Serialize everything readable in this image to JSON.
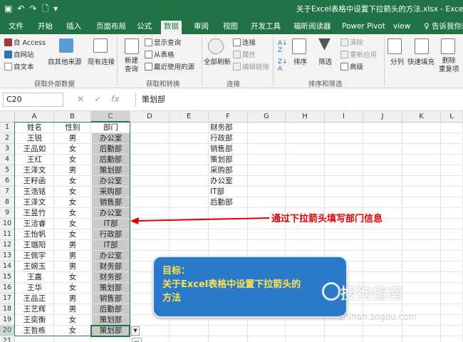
{
  "window": {
    "title": "关于Excel表格中设置下拉箭头的方法.xlsx - Excel"
  },
  "qat": {
    "save_icon": "save-icon",
    "undo_icon": "undo-icon",
    "redo_icon": "redo-icon",
    "print_preview_icon": "print-preview-icon",
    "customize_icon": "customize-icon"
  },
  "ribbon_tabs": [
    "文件",
    "开始",
    "插入",
    "页面布局",
    "公式",
    "数据",
    "审阅",
    "视图",
    "开发工具",
    "福昕阅读器",
    "Power Pivot",
    "view",
    "告诉我你想"
  ],
  "active_tab": "数据",
  "ribbon": {
    "from_access": "自 Access",
    "from_web": "自网站",
    "from_text": "自文本",
    "from_other": "自其他来源",
    "existing_conn": "现有连接",
    "group_external": "获取外部数据",
    "new_query_line1": "新建",
    "new_query_line2": "查询",
    "show_queries": "显示查询",
    "from_table": "从表格",
    "recent_sources": "最近使用的源",
    "group_transform": "获取和转换",
    "refresh_all": "全部刷新",
    "connections": "连接",
    "properties": "属性",
    "edit_links": "编辑链接",
    "group_connections": "连接",
    "sort": "排序",
    "filter": "筛选",
    "clear": "清除",
    "reapply": "重新应用",
    "advanced": "高级",
    "group_sort": "排序和筛选",
    "text_to_columns": "分列",
    "flash_fill": "快速填充",
    "remove_dup_line1": "删除",
    "remove_dup_line2": "重复项"
  },
  "formula_bar": {
    "name_box": "C20",
    "cancel_icon": "✕",
    "enter_icon": "✓",
    "fx_icon": "fx",
    "value": "策划部"
  },
  "columns": [
    "A",
    "B",
    "C",
    "D",
    "E",
    "F",
    "G",
    "H",
    "I",
    "J",
    "K",
    "L"
  ],
  "rows": [
    "1",
    "2",
    "3",
    "4",
    "5",
    "6",
    "7",
    "8",
    "9",
    "10",
    "11",
    "12",
    "13",
    "14",
    "15",
    "16",
    "17",
    "18",
    "19",
    "20",
    "21"
  ],
  "table": {
    "headers": [
      "姓名",
      "性别",
      "部门"
    ],
    "data": [
      [
        "王锐",
        "男",
        "办公室"
      ],
      [
        "王品如",
        "女",
        "后勤部"
      ],
      [
        "王红",
        "女",
        "后勤部"
      ],
      [
        "王泽文",
        "男",
        "策划部"
      ],
      [
        "王籽函",
        "女",
        "办公室"
      ],
      [
        "王浩铭",
        "女",
        "采购部"
      ],
      [
        "王泽文",
        "女",
        "销售部"
      ],
      [
        "王昱竹",
        "女",
        "办公室"
      ],
      [
        "王洽睿",
        "女",
        "IT部"
      ],
      [
        "王怡帆",
        "女",
        "行政部"
      ],
      [
        "王璐阳",
        "男",
        "IT部"
      ],
      [
        "王佩宇",
        "男",
        "办公室"
      ],
      [
        "王婉玉",
        "男",
        "财务部"
      ],
      [
        "王嘉",
        "女",
        "财务部"
      ],
      [
        "王华",
        "女",
        "策划部"
      ],
      [
        "王品正",
        "男",
        "销售部"
      ],
      [
        "王艺辉",
        "男",
        "后勤部"
      ],
      [
        "王奕衡",
        "女",
        "策划部"
      ],
      [
        "王哲栋",
        "女",
        "策划部"
      ]
    ]
  },
  "dept_list": [
    "财务部",
    "行政部",
    "销售部",
    "策划部",
    "采购部",
    "办公室",
    "IT部",
    "后勤部"
  ],
  "annotation": "通过下拉箭头填写部门信息",
  "callout": {
    "line1": "目标：",
    "line2": "关于Excel表格中设置下拉箭头的",
    "line3": "方法"
  },
  "watermark": {
    "brand": "搜狗指南",
    "url": "zhinan.sogou.com"
  },
  "colors": {
    "excel_green": "#217346",
    "annotation_red": "#e00000",
    "callout_blue": "#2b79c9",
    "callout_text": "#ffe34d"
  }
}
